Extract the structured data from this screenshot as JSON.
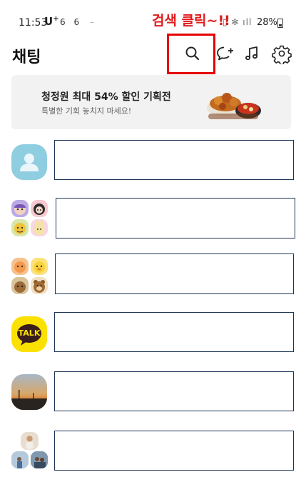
{
  "status_bar": {
    "time": "11:53",
    "carrier": "U",
    "carrier_sup": "+",
    "indicators": "6 6",
    "dash": "–",
    "system_icons": "▯ ✻ ıll",
    "battery": "28%"
  },
  "annotation": "검색 클릭~!!",
  "header": {
    "title": "채팅",
    "icons": [
      "search-icon",
      "new-chat-icon",
      "music-icon",
      "settings-icon"
    ]
  },
  "banner": {
    "title": "청정원 최대 54% 할인 기획전",
    "subtitle": "특별한 기회 놓치지 마세요!"
  },
  "avatar_texts": {
    "talk": "TALK"
  },
  "colors": {
    "annotation": "#e31b1b",
    "highlight_border": "#e50000",
    "placeholder_border": "#1d3557",
    "banner_bg": "#f2f2f2",
    "kakao_yellow": "#fae100"
  }
}
